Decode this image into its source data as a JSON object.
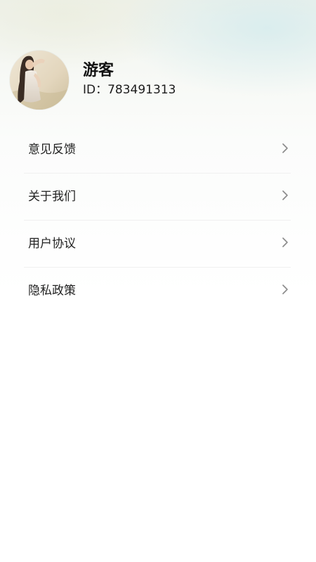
{
  "profile": {
    "name": "游客",
    "id_text": "ID：783491313",
    "avatar_icon": "avatar-photo"
  },
  "menu": {
    "items": [
      {
        "label": "意见反馈",
        "icon": "chevron-right-icon"
      },
      {
        "label": "关于我们",
        "icon": "chevron-right-icon"
      },
      {
        "label": "用户协议",
        "icon": "chevron-right-icon"
      },
      {
        "label": "隐私政策",
        "icon": "chevron-right-icon"
      }
    ]
  },
  "colors": {
    "background": "#ffffff",
    "header_tint": "#eef1ea",
    "text_primary": "#111111",
    "chevron": "#8a8a8a",
    "divider": "#f0f0f0"
  }
}
